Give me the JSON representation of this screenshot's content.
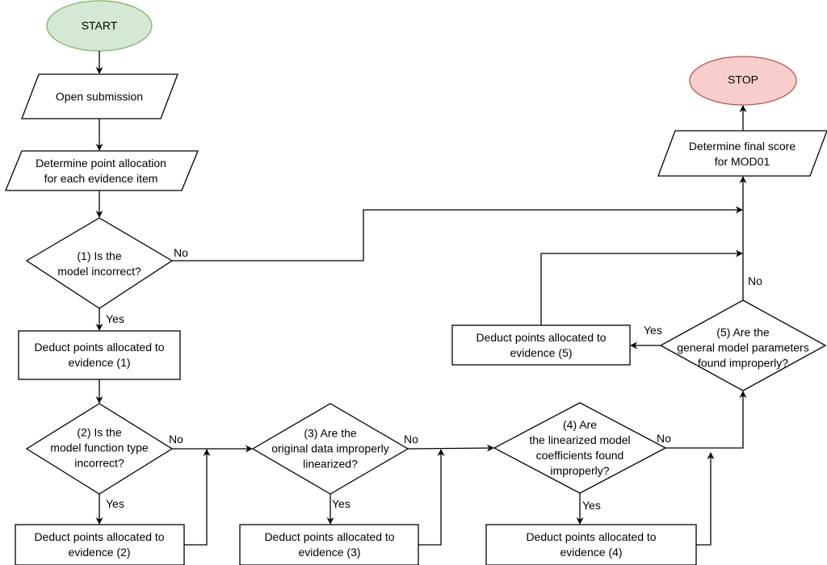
{
  "diagram": {
    "colors": {
      "start_fill": "#d5e8d4",
      "start_stroke": "#82b366",
      "stop_fill": "#f8cecc",
      "stop_stroke": "#b85450",
      "line": "#000000"
    },
    "nodes": {
      "start": {
        "label": "START",
        "shape": "terminator"
      },
      "open_submission": {
        "label": "Open submission",
        "shape": "input-output"
      },
      "point_allocation": {
        "label_lines": [
          "Determine point allocation",
          "for each evidence item"
        ],
        "shape": "input-output"
      },
      "decision_1": {
        "label_lines": [
          "(1) Is the",
          "model incorrect?"
        ],
        "shape": "decision"
      },
      "deduct_1": {
        "label_lines": [
          "Deduct points allocated to",
          "evidence (1)"
        ],
        "shape": "process"
      },
      "decision_2": {
        "label_lines": [
          "(2) Is the",
          "model function type",
          "incorrect?"
        ],
        "shape": "decision"
      },
      "deduct_2": {
        "label_lines": [
          "Deduct points allocated to",
          "evidence (2)"
        ],
        "shape": "process"
      },
      "decision_3": {
        "label_lines": [
          "(3) Are the",
          "original data improperly",
          "linearized?"
        ],
        "shape": "decision"
      },
      "deduct_3": {
        "label_lines": [
          "Deduct points allocated to",
          "evidence (3)"
        ],
        "shape": "process"
      },
      "decision_4": {
        "label_lines": [
          "(4) Are",
          "the linearized model",
          "coefficients found",
          "improperly?"
        ],
        "shape": "decision"
      },
      "deduct_4": {
        "label_lines": [
          "Deduct points allocated to",
          "evidence (4)"
        ],
        "shape": "process"
      },
      "decision_5": {
        "label_lines": [
          "(5) Are the",
          "general model parameters",
          "found improperly?"
        ],
        "shape": "decision"
      },
      "deduct_5": {
        "label_lines": [
          "Deduct points allocated to",
          "evidence (5)"
        ],
        "shape": "process"
      },
      "final_score": {
        "label_lines": [
          "Determine final score",
          "for MOD01"
        ],
        "shape": "input-output"
      },
      "stop": {
        "label": "STOP",
        "shape": "terminator"
      }
    },
    "edge_labels": {
      "d1_no": "No",
      "d1_yes": "Yes",
      "d2_no": "No",
      "d2_yes": "Yes",
      "d3_no": "No",
      "d3_yes": "Yes",
      "d4_no": "No",
      "d4_yes": "Yes",
      "d5_no": "No",
      "d5_yes": "Yes"
    },
    "edges": [
      {
        "from": "start",
        "to": "open_submission"
      },
      {
        "from": "open_submission",
        "to": "point_allocation"
      },
      {
        "from": "point_allocation",
        "to": "decision_1"
      },
      {
        "from": "decision_1",
        "to": "final_score",
        "label": "No"
      },
      {
        "from": "decision_1",
        "to": "deduct_1",
        "label": "Yes"
      },
      {
        "from": "deduct_1",
        "to": "decision_2"
      },
      {
        "from": "decision_2",
        "to": "decision_3",
        "label": "No"
      },
      {
        "from": "decision_2",
        "to": "deduct_2",
        "label": "Yes"
      },
      {
        "from": "deduct_2",
        "to": "decision_3"
      },
      {
        "from": "decision_3",
        "to": "decision_4",
        "label": "No"
      },
      {
        "from": "decision_3",
        "to": "deduct_3",
        "label": "Yes"
      },
      {
        "from": "deduct_3",
        "to": "decision_4"
      },
      {
        "from": "decision_4",
        "to": "decision_5",
        "label": "No"
      },
      {
        "from": "decision_4",
        "to": "deduct_4",
        "label": "Yes"
      },
      {
        "from": "deduct_4",
        "to": "decision_5"
      },
      {
        "from": "decision_5",
        "to": "final_score",
        "label": "No"
      },
      {
        "from": "decision_5",
        "to": "deduct_5",
        "label": "Yes"
      },
      {
        "from": "deduct_5",
        "to": "final_score"
      },
      {
        "from": "final_score",
        "to": "stop"
      }
    ]
  }
}
